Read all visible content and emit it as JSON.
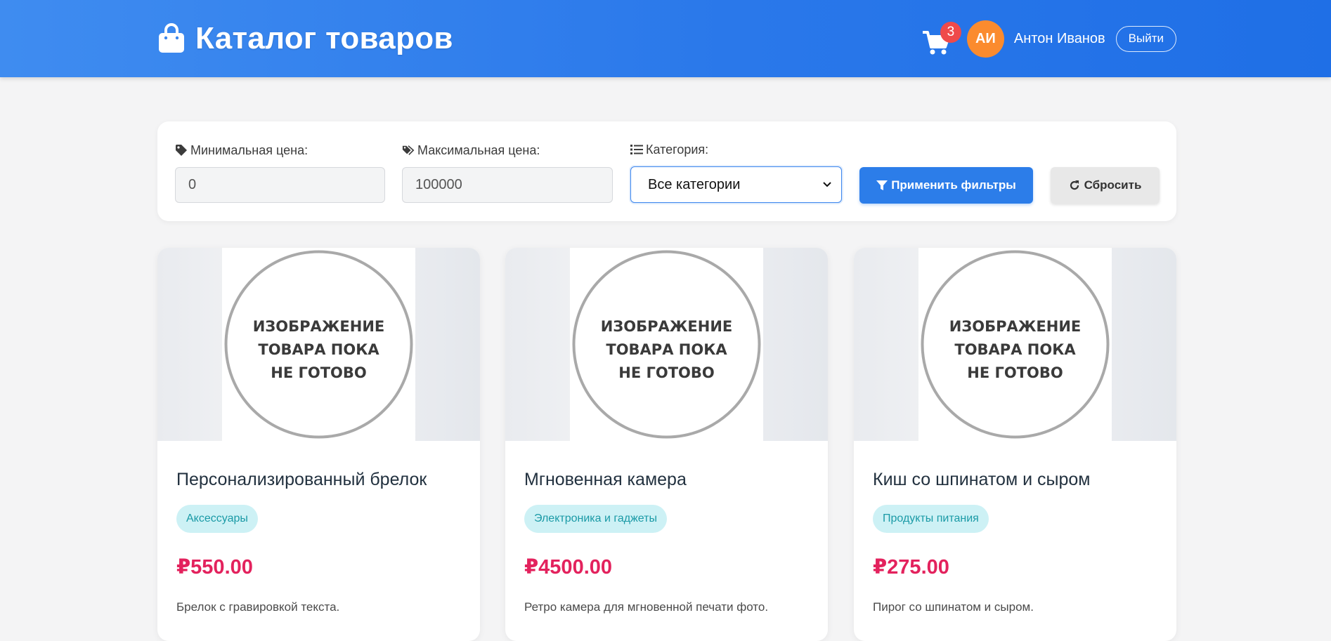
{
  "header": {
    "title": "Каталог товаров",
    "brand_icon": "shopping-bag-icon",
    "cart_icon": "shopping-cart-icon",
    "cart_count": "3",
    "avatar_initials": "АИ",
    "user_name": "Антон Иванов",
    "logout_label": "Выйти",
    "colors": {
      "gradient_start": "#3f8cf0",
      "gradient_end": "#1f6fe6",
      "badge": "#ef4a4a",
      "avatar": "#fb8b2e"
    }
  },
  "filters": {
    "min_price": {
      "label": "Минимальная цена:",
      "value": "0",
      "icon": "tag-icon"
    },
    "max_price": {
      "label": "Максимальная цена:",
      "value": "100000",
      "icon": "tags-icon"
    },
    "category": {
      "label": "Категория:",
      "selected": "Все категории",
      "icon": "list-icon"
    },
    "apply_label": "Применить фильтры",
    "apply_icon": "filter-icon",
    "reset_label": "Сбросить",
    "reset_icon": "refresh-icon",
    "colors": {
      "apply": "#2c7de9",
      "reset": "#e8e8e8"
    }
  },
  "products": [
    {
      "title": "Персонализированный брелок",
      "category": "Аксессуары",
      "price": "₽550.00",
      "description": "Брелок с гравировкой текста.",
      "image_text": [
        "ИЗОБРАЖЕНИЕ",
        "ТОВАРА ПОКА",
        "НЕ ГОТОВО"
      ]
    },
    {
      "title": "Мгновенная камера",
      "category": "Электроника и гаджеты",
      "price": "₽4500.00",
      "description": "Ретро камера для мгновенной печати фото.",
      "image_text": [
        "ИЗОБРАЖЕНИЕ",
        "ТОВАРА ПОКА",
        "НЕ ГОТОВО"
      ]
    },
    {
      "title": "Киш со шпинатом и сыром",
      "category": "Продукты питания",
      "price": "₽275.00",
      "description": "Пирог со шпинатом и сыром.",
      "image_text": [
        "ИЗОБРАЖЕНИЕ",
        "ТОВАРА ПОКА",
        "НЕ ГОТОВО"
      ]
    }
  ],
  "colors": {
    "price": "#e3225d",
    "tag_bg": "#cdf1f5",
    "tag_text": "#1a9aa6"
  }
}
